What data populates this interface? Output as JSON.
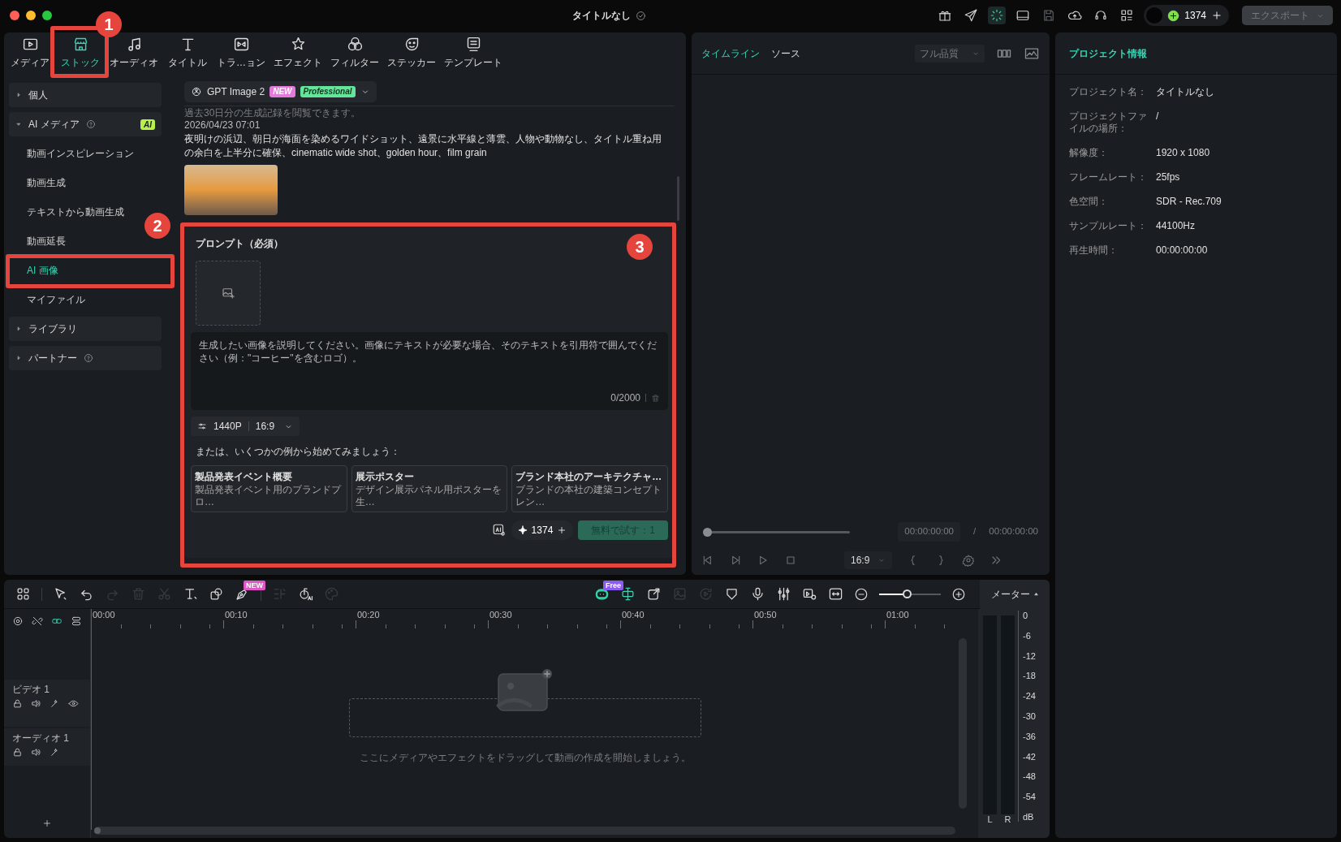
{
  "window": {
    "title": "タイトルなし",
    "saved": true
  },
  "top_bar": {
    "credits": "1374",
    "export_button": "エクスポート",
    "export_disabled": true
  },
  "media_tabs": [
    {
      "label": "メディア",
      "selected": false
    },
    {
      "label": "ストック",
      "selected": true
    },
    {
      "label": "オーディオ",
      "selected": false
    },
    {
      "label": "タイトル",
      "selected": false
    },
    {
      "label": "トラ…ョン",
      "selected": false
    },
    {
      "label": "エフェクト",
      "selected": false
    },
    {
      "label": "フィルター",
      "selected": false
    },
    {
      "label": "ステッカー",
      "selected": false
    },
    {
      "label": "テンプレート",
      "selected": false
    }
  ],
  "sidebar": {
    "items": [
      {
        "label": "個人",
        "expanded": false,
        "help": false
      },
      {
        "label": "AI メディア",
        "expanded": true,
        "help": true,
        "badge": "AI",
        "children": [
          {
            "label": "動画インスピレーション",
            "selected": false
          },
          {
            "label": "動画生成",
            "selected": false
          },
          {
            "label": "テキストから動画生成",
            "selected": false
          },
          {
            "label": "動画延長",
            "selected": false
          },
          {
            "label": "AI 画像",
            "selected": true
          },
          {
            "label": "マイファイル",
            "selected": false
          }
        ]
      },
      {
        "label": "ライブラリ",
        "expanded": false,
        "help": false
      },
      {
        "label": "パートナー",
        "expanded": false,
        "help": true
      }
    ]
  },
  "generator": {
    "model": "GPT Image 2",
    "badges": [
      "NEW",
      "Professional"
    ],
    "history_note": "過去30日分の生成記録を閲覧できます。",
    "history": [
      {
        "date": "2026/04/23 07:01",
        "prompt": "夜明けの浜辺、朝日が海面を染めるワイドショット、遠景に水平線と薄雲、人物や動物なし、タイトル重ね用の余白を上半分に確保、cinematic wide shot、golden hour、film grain"
      }
    ],
    "prompt_panel": {
      "title": "プロンプト（必須）",
      "placeholder": "生成したい画像を説明してください。画像にテキストが必要な場合、そのテキストを引用符で囲んでください（例：\"コーヒー\"を含むロゴ）。",
      "count": "0/2000",
      "resolution": "1440P",
      "aspect": "16:9",
      "examples_heading": "または、いくつかの例から始めてみましょう：",
      "examples": [
        {
          "title": "製品発表イベント概要",
          "description": "製品発表イベント用のブランドプロ…"
        },
        {
          "title": "展示ポスター",
          "description": "デザイン展示パネル用ポスターを生…"
        },
        {
          "title": "ブランド本社のアーキテクチャ…",
          "description": "ブランドの本社の建築コンセプトレン…"
        }
      ],
      "credits": "1374",
      "generate_button": "無料で試す：1",
      "generate_disabled": true
    }
  },
  "player": {
    "tabs": [
      {
        "label": "タイムライン",
        "selected": true
      },
      {
        "label": "ソース",
        "selected": false
      }
    ],
    "quality": "フル品質",
    "level": 0,
    "current_time": "00:00:00:00",
    "separator": "/",
    "total_time": "00:00:00:00",
    "aspect": "16:9"
  },
  "project_info": {
    "title": "プロジェクト情報",
    "rows": [
      {
        "label": "プロジェクト名：",
        "value": "タイトルなし"
      },
      {
        "label": "プロジェクトファイルの場所：",
        "value": "/"
      },
      {
        "label": "解像度：",
        "value": "1920 x 1080"
      },
      {
        "label": "フレームレート：",
        "value": "25fps"
      },
      {
        "label": "色空間：",
        "value": "SDR - Rec.709"
      },
      {
        "label": "サンプルレート：",
        "value": "44100Hz"
      },
      {
        "label": "再生時間：",
        "value": "00:00:00:00"
      }
    ]
  },
  "timeline": {
    "tools_left": [
      {
        "kind": "layout",
        "disabled": false
      },
      {
        "kind": "select",
        "disabled": false
      },
      {
        "kind": "undo",
        "disabled": false
      },
      {
        "kind": "redo",
        "disabled": true
      },
      {
        "kind": "delete",
        "disabled": true
      },
      {
        "kind": "cut",
        "disabled": true
      },
      {
        "kind": "text",
        "disabled": false
      },
      {
        "kind": "shapes",
        "disabled": false
      },
      {
        "kind": "pen",
        "disabled": false,
        "badge": "NEW"
      },
      {
        "kind": "speed",
        "disabled": true
      },
      {
        "kind": "audio_ai",
        "disabled": false
      },
      {
        "kind": "palette",
        "disabled": true
      }
    ],
    "tools_right": [
      {
        "kind": "robot",
        "disabled": false,
        "badge": "Free"
      },
      {
        "kind": "split",
        "disabled": false
      },
      {
        "kind": "export",
        "disabled": false
      },
      {
        "kind": "image",
        "disabled": true
      },
      {
        "kind": "rotate",
        "disabled": true
      },
      {
        "kind": "shield",
        "disabled": false
      },
      {
        "kind": "mic",
        "disabled": false
      },
      {
        "kind": "mixer",
        "disabled": false
      },
      {
        "kind": "screen",
        "disabled": false
      },
      {
        "kind": "fit",
        "disabled": false
      }
    ],
    "zoom": {
      "level": 0.45
    },
    "meter_label": "メーター",
    "ruler": [
      "00:00",
      "00:10",
      "00:20",
      "00:30",
      "00:40",
      "00:50",
      "01:00"
    ],
    "tracks": [
      {
        "name": "ビデオ 1",
        "kind": "video"
      },
      {
        "name": "オーディオ 1",
        "kind": "audio"
      }
    ],
    "drop_hint": "ここにメディアやエフェクトをドラッグして動画の作成を開始しましょう。",
    "meter": {
      "scale": [
        "0",
        "-6",
        "-12",
        "-18",
        "-24",
        "-30",
        "-36",
        "-42",
        "-48",
        "-54"
      ],
      "unit": "dB",
      "channels": [
        "L",
        "R"
      ]
    }
  },
  "callouts": [
    {
      "number": "1"
    },
    {
      "number": "2"
    },
    {
      "number": "3"
    }
  ]
}
